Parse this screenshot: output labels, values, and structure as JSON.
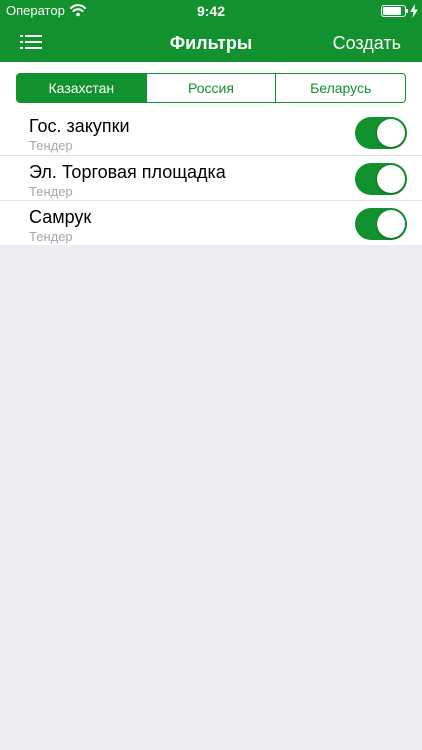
{
  "status_bar": {
    "carrier": "Оператор",
    "time": "9:42",
    "icons": [
      "wifi-icon",
      "battery-icon",
      "charging-bolt-icon"
    ]
  },
  "navbar": {
    "menu_icon": "list-menu-icon",
    "title": "Фильтры",
    "create_label": "Создать"
  },
  "segments": {
    "selected_index": 0,
    "items": [
      {
        "label": "Казахстан"
      },
      {
        "label": "Россия"
      },
      {
        "label": "Беларусь"
      }
    ]
  },
  "filters": [
    {
      "title": "Гос. закупки",
      "subtitle": "Тендер",
      "enabled": true
    },
    {
      "title": "Эл. Торговая площадка",
      "subtitle": "Тендер",
      "enabled": true
    },
    {
      "title": "Самрук",
      "subtitle": "Тендер",
      "enabled": true
    }
  ],
  "colors": {
    "accent": "#12922f",
    "background": "#eeeef2",
    "subtitle": "#a7a7ab"
  }
}
